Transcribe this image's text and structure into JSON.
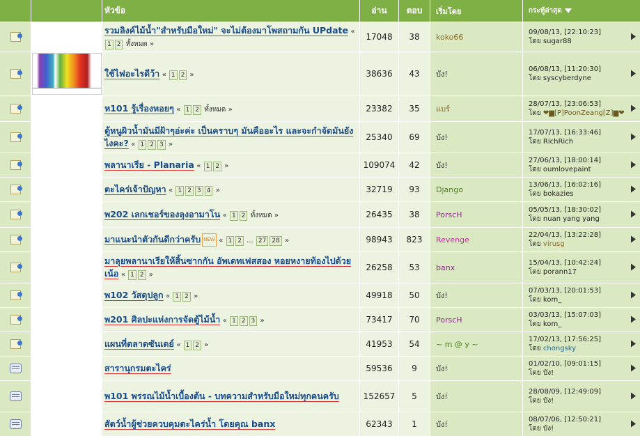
{
  "header": {
    "topic": "หัวข้อ",
    "views": "อ่าน",
    "replies": "ตอบ",
    "starter": "เริ่มโดย",
    "last": "กระทู้ล่าสุด"
  },
  "by_label": "โดย",
  "rows": [
    {
      "icon": "hot",
      "title": "รวมลิงค์ไม้น้ำ\"สำหรับมือใหม่\" จะไม่ต้องมาโพสถามกัน UPdate",
      "pages": "« 1 2 ทั้งหมด »",
      "views": "17048",
      "replies": "38",
      "starter": "koko66",
      "starter_color": "#8a6a2a",
      "last_date": "09/08/13, [22:10:23]",
      "last_user": "sugar88",
      "height": 42
    },
    {
      "icon": "hot",
      "title": "ใช้ไฟอะไรดีว้า",
      "pages": "« 1 2 »",
      "views": "38636",
      "replies": "43",
      "starter": "บัง!",
      "starter_color": "#333333",
      "last_date": "06/08/13, [11:20:30]",
      "last_user": "syscyberdyne",
      "height": 62,
      "thumb": true
    },
    {
      "icon": "hot",
      "title": "ห101 รู้เรื่องหอยๆ",
      "pages": "« 1 2 ทั้งหมด »",
      "views": "23382",
      "replies": "35",
      "starter": "แบร์",
      "starter_color": "#8a6a2a",
      "last_date": "28/07/13, [23:06:53]",
      "last_user": "❤▆[P]PoonZeang[Z]▆❤",
      "last_color": "#6a5a20",
      "height": 36
    },
    {
      "icon": "hot",
      "title": "ตู้หนูผิวน้ำมันมีฝ้าๆอ่ะค่ะ เป็นคราบๆ มันคืออะไร และจะกำจัดมันยังไงคะ?",
      "pages": "« 1 2 3 »",
      "views": "25340",
      "replies": "69",
      "starter": "บัง!",
      "starter_color": "#333333",
      "last_date": "17/07/13, [16:33:46]",
      "last_user": "RichRich",
      "height": 44
    },
    {
      "icon": "hot",
      "title": "พลานาเรีย - Planaria",
      "pages": "« 1 2 »",
      "views": "109074",
      "replies": "42",
      "starter": "บัง!",
      "starter_color": "#333333",
      "last_date": "27/06/13, [18:00:14]",
      "last_user": "oumlovepaint",
      "height": 34
    },
    {
      "icon": "hot",
      "title": "ตะไคร่เจ้าปัญหา",
      "pages": "« 1 2 3 4 »",
      "views": "32719",
      "replies": "93",
      "starter": "Django",
      "starter_color": "#4a7a20",
      "last_date": "13/06/13, [16:02:16]",
      "last_user": "bokazies",
      "height": 34
    },
    {
      "icon": "hot",
      "title": "พ202 เลกเชอร์ของลุงอามาโน",
      "pages": "« 1 2 ทั้งหมด »",
      "views": "26435",
      "replies": "38",
      "starter": "PorscH",
      "starter_color": "#8a2a8a",
      "last_date": "05/05/13, [18:30:02]",
      "last_user": "nuan yang yang",
      "height": 36
    },
    {
      "icon": "hot",
      "title": "มาแนะนำตัวกันดีกว่าครับ",
      "new": "NEW",
      "pages": "« 1 2 ... 27 28 »",
      "views": "98943",
      "replies": "823",
      "starter": "Revenge",
      "starter_color": "#c030a0",
      "last_date": "22/04/13, [13:22:28]",
      "last_user": "virusg",
      "last_color": "#8a6a2a",
      "height": 34
    },
    {
      "icon": "hot",
      "title": "มาลุยพลานาเรียให้สิ้นซากกัน อัพเดทเฟสสอง หอยหงายท้องไปด้วยเน้อ",
      "pages": "« 1 2 »",
      "views": "26258",
      "replies": "53",
      "starter": "banx",
      "starter_color": "#8a2a8a",
      "last_date": "15/04/13, [10:42:24]",
      "last_user": "porann17",
      "height": 44
    },
    {
      "icon": "hot",
      "title": "พ102 วัสดุปลูก",
      "pages": "« 1 2 »",
      "views": "49918",
      "replies": "50",
      "starter": "บัง!",
      "starter_color": "#333333",
      "last_date": "07/03/13, [20:01:53]",
      "last_user": "kom_",
      "height": 34
    },
    {
      "icon": "hot",
      "title": "พ201 ศิลปะแห่งการจัดตู้ไม้น้ำ",
      "pages": "« 1 2 3 »",
      "views": "73417",
      "replies": "70",
      "starter": "PorscH",
      "starter_color": "#8a2a8a",
      "last_date": "03/03/13, [15:07:03]",
      "last_user": "kom_",
      "height": 34
    },
    {
      "icon": "hot",
      "title": "แผนที่ตลาดซันเดย์",
      "pages": "« 1 2 »",
      "views": "41953",
      "replies": "54",
      "starter": "~ m @ y ~",
      "starter_color": "#4a7a20",
      "last_date": "17/02/13, [17:56:25]",
      "last_user": "chongsky",
      "last_color": "#2a6a8a",
      "height": 34
    },
    {
      "icon": "sticky",
      "title": "สารานุกรมตะไคร่",
      "pages": "",
      "views": "59536",
      "replies": "9",
      "starter": "บัง!",
      "starter_color": "#333333",
      "last_date": "01/02/10, [09:01:15]",
      "last_user": "บัง!",
      "height": 34
    },
    {
      "icon": "sticky",
      "title": "พ101 พรรณไม้น้ำเบื้องต้น - บทความสำหรับมือใหม่ทุกคนครับ",
      "pages": "",
      "views": "152657",
      "replies": "5",
      "starter": "บัง!",
      "starter_color": "#333333",
      "last_date": "28/08/09, [12:49:09]",
      "last_user": "บัง!",
      "height": 44
    },
    {
      "icon": "sticky",
      "title": "สัตว์น้ำผู้ช่วยควบคุมตะไคร่น้ำ โดยคุณ banx",
      "pages": "",
      "views": "62343",
      "replies": "1",
      "starter": "บัง!",
      "starter_color": "#333333",
      "last_date": "08/07/06, [12:50:21]",
      "last_user": "บัง!",
      "height": 34
    }
  ]
}
